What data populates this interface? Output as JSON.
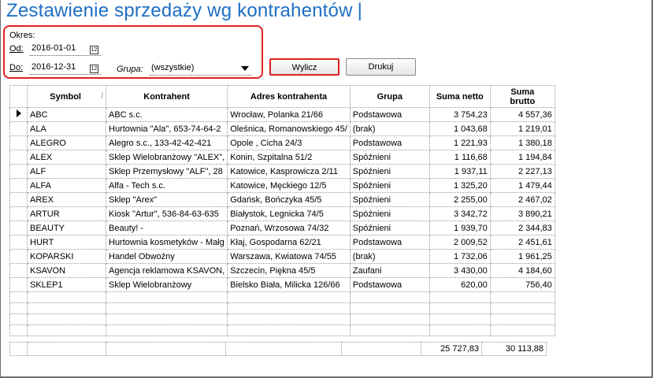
{
  "title": "Zestawienie sprzedaży wg kontrahentów",
  "period": {
    "label": "Okres:",
    "from_label": "Od:",
    "from_value": "2016-01-01",
    "to_label": "Do:",
    "to_value": "2016-12-31",
    "group_label": "Grupa:",
    "group_value": "(wszystkie)"
  },
  "buttons": {
    "calculate": "Wylicz",
    "print": "Drukuj"
  },
  "table": {
    "columns": [
      "Symbol",
      "Kontrahent",
      "Adres kontrahenta",
      "Grupa",
      "Suma netto",
      "Suma brutto"
    ],
    "rows": [
      {
        "symbol": "ABC",
        "contractor": "ABC s.c.",
        "address": "Wrocław, Polanka 21/66",
        "group": "Podstawowa",
        "net": "3 754,23",
        "gross": "4 557,36"
      },
      {
        "symbol": "ALA",
        "contractor": "Hurtownia \"Ala\", 653-74-64-2",
        "address": "Oleśnica, Romanowskiego 45/",
        "group": "(brak)",
        "net": "1 043,68",
        "gross": "1 219,01"
      },
      {
        "symbol": "ALEGRO",
        "contractor": "Alegro s.c., 133-42-42-421",
        "address": "Opole , Cicha 24/3",
        "group": "Podstawowa",
        "net": "1 221,93",
        "gross": "1 380,18"
      },
      {
        "symbol": "ALEX",
        "contractor": "Sklep Wielobranżowy  \"ALEX\",",
        "address": "Konin, Szpitalna 51/2",
        "group": "Spóźnieni",
        "net": "1 116,68",
        "gross": "1 194,84"
      },
      {
        "symbol": "ALF",
        "contractor": "Sklep Przemysłowy \"ALF\", 28",
        "address": "Katowice, Kasprowicza 2/11",
        "group": "Spóźnieni",
        "net": "1 937,11",
        "gross": "2 227,13"
      },
      {
        "symbol": "ALFA",
        "contractor": "Alfa - Tech s.c.",
        "address": "Katowice, Męckiego 12/5",
        "group": "Spóźnieni",
        "net": "1 325,20",
        "gross": "1 479,44"
      },
      {
        "symbol": "AREX",
        "contractor": "Sklep \"Arex\"",
        "address": "Gdańsk, Bończyka 45/5",
        "group": "Spóźnieni",
        "net": "2 255,00",
        "gross": "2 467,02"
      },
      {
        "symbol": "ARTUR",
        "contractor": "Kiosk \"Artur\", 536-84-63-635",
        "address": "Białystok, Legnicka 74/5",
        "group": "Spóźnieni",
        "net": "3 342,72",
        "gross": "3 890,21"
      },
      {
        "symbol": "BEAUTY",
        "contractor": "Beauty! -",
        "address": "Poznań, Wrzosowa 74/32",
        "group": "Spóźnieni",
        "net": "1 939,70",
        "gross": "2 344,83"
      },
      {
        "symbol": "HURT",
        "contractor": "Hurtownia kosmetyków - Małg",
        "address": "Kłaj, Gospodarna 62/21",
        "group": "Podstawowa",
        "net": "2 009,52",
        "gross": "2 451,61"
      },
      {
        "symbol": "KOPARSKI",
        "contractor": "Handel Obwoźny",
        "address": "Warszawa, Kwiatowa 74/55",
        "group": "(brak)",
        "net": "1 732,06",
        "gross": "1 961,25"
      },
      {
        "symbol": "KSAVON",
        "contractor": "Agencja reklamowa KSAVON,",
        "address": "Szczecin, Piękna 45/5",
        "group": "Zaufani",
        "net": "3 430,00",
        "gross": "4 184,60"
      },
      {
        "symbol": "SKLEP1",
        "contractor": "Sklep Wielobranżowy",
        "address": "Bielsko Biała, Milicka 126/66",
        "group": "Podstawowa",
        "net": "620,00",
        "gross": "756,40"
      }
    ],
    "totals": {
      "net": "25 727,83",
      "gross": "30 113,88"
    }
  }
}
